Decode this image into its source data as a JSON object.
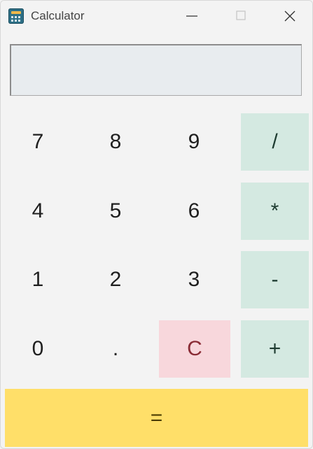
{
  "window": {
    "title": "Calculator"
  },
  "controls": {
    "minimize": "minimize-icon",
    "maximize": "maximize-icon",
    "close": "close-icon"
  },
  "display": {
    "value": ""
  },
  "keys": {
    "k7": "7",
    "k8": "8",
    "k9": "9",
    "div": "/",
    "k4": "4",
    "k5": "5",
    "k6": "6",
    "mul": "*",
    "k1": "1",
    "k2": "2",
    "k3": "3",
    "sub": "-",
    "k0": "0",
    "dot": ".",
    "clear": "C",
    "add": "+",
    "eq": "="
  },
  "colors": {
    "operator_bg": "#d4e9e1",
    "clear_bg": "#f8d7dc",
    "equals_bg": "#ffdf69",
    "display_bg": "#e8ecef"
  }
}
